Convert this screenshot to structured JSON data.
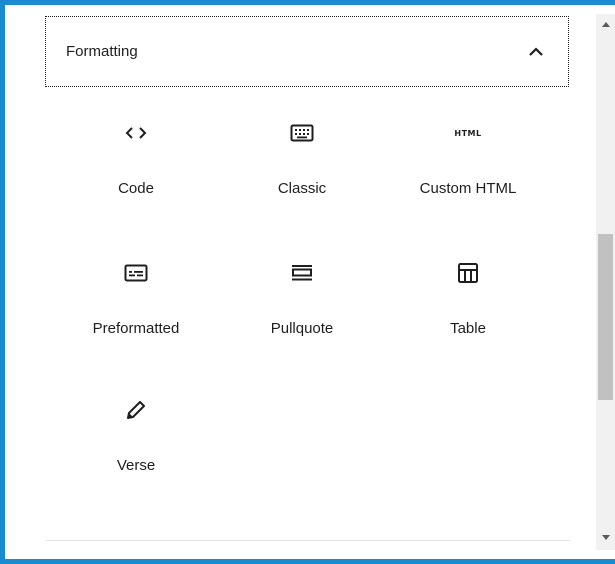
{
  "section": {
    "title": "Formatting",
    "expanded": true
  },
  "blocks": [
    {
      "label": "Code",
      "icon": "code-icon"
    },
    {
      "label": "Classic",
      "icon": "keyboard-icon"
    },
    {
      "label": "Custom HTML",
      "icon": "html-icon",
      "icon_text": "HTML"
    },
    {
      "label": "Preformatted",
      "icon": "preformatted-icon"
    },
    {
      "label": "Pullquote",
      "icon": "pullquote-icon"
    },
    {
      "label": "Table",
      "icon": "table-icon"
    },
    {
      "label": "Verse",
      "icon": "pencil-icon"
    }
  ],
  "colors": {
    "frame": "#1a8bd0",
    "text": "#1e1e1e",
    "scrollbar_thumb": "#c1c1c1"
  }
}
